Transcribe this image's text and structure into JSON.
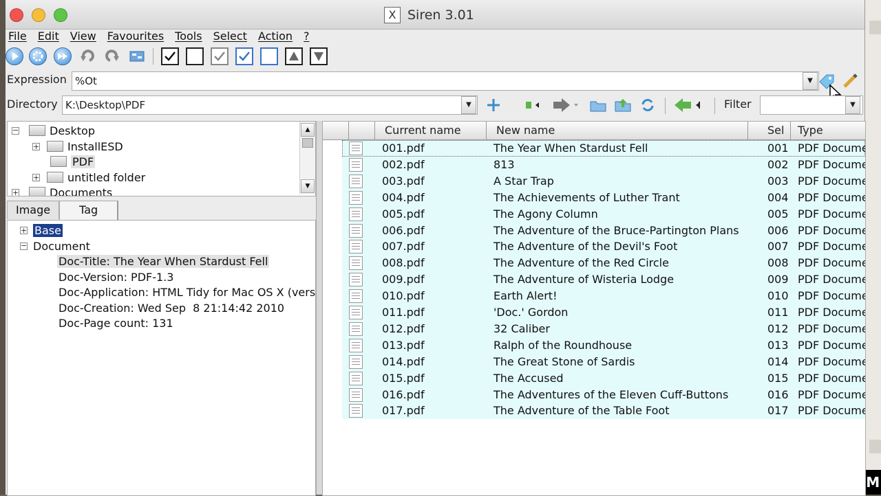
{
  "window": {
    "title": "Siren 3.01",
    "logo_glyph": "X"
  },
  "menu": [
    "File",
    "Edit",
    "View",
    "Favourites",
    "Tools",
    "Select",
    "Action",
    "?"
  ],
  "expression": {
    "label": "Expression",
    "value": "%Ot"
  },
  "directory": {
    "label": "Directory",
    "value": "K:\\Desktop\\PDF"
  },
  "filter": {
    "label": "Filter",
    "value": ""
  },
  "tree": {
    "items": [
      {
        "label": "Desktop",
        "expander": "−"
      },
      {
        "label": "InstallESD",
        "expander": "+"
      },
      {
        "label": "PDF",
        "expander": ""
      },
      {
        "label": "untitled folder",
        "expander": "+"
      },
      {
        "label": "Documents",
        "expander": "+"
      }
    ]
  },
  "tabs": [
    "Image",
    "Tag"
  ],
  "tag_tree": {
    "base": "Base",
    "document": "Document",
    "entries": [
      "Doc-Title: The Year When Stardust Fell",
      "Doc-Version: PDF-1.3",
      "Doc-Application: HTML Tidy for Mac OS X (vers",
      "Doc-Creation: Wed Sep  8 21:14:42 2010",
      "Doc-Page count: 131"
    ]
  },
  "list": {
    "columns": [
      "Current name",
      "New name",
      "Sel",
      "Type"
    ],
    "rows": [
      [
        "001.pdf",
        "The Year When Stardust Fell",
        "001",
        "PDF Docume"
      ],
      [
        "002.pdf",
        "813",
        "002",
        "PDF Docume"
      ],
      [
        "003.pdf",
        "A Star Trap",
        "003",
        "PDF Docume"
      ],
      [
        "004.pdf",
        "The Achievements of Luther Trant",
        "004",
        "PDF Docume"
      ],
      [
        "005.pdf",
        "The Agony Column",
        "005",
        "PDF Docume"
      ],
      [
        "006.pdf",
        "The Adventure of the Bruce-Partington Plans",
        "006",
        "PDF Docume"
      ],
      [
        "007.pdf",
        "The Adventure of the Devil's Foot",
        "007",
        "PDF Docume"
      ],
      [
        "008.pdf",
        "The Adventure of the Red Circle",
        "008",
        "PDF Docume"
      ],
      [
        "009.pdf",
        "The Adventure of Wisteria Lodge",
        "009",
        "PDF Docume"
      ],
      [
        "010.pdf",
        "Earth Alert!",
        "010",
        "PDF Docume"
      ],
      [
        "011.pdf",
        "'Doc.' Gordon",
        "011",
        "PDF Docume"
      ],
      [
        "012.pdf",
        "32 Caliber",
        "012",
        "PDF Docume"
      ],
      [
        "013.pdf",
        "Ralph of the Roundhouse",
        "013",
        "PDF Docume"
      ],
      [
        "014.pdf",
        "The Great Stone of Sardis",
        "014",
        "PDF Docume"
      ],
      [
        "015.pdf",
        "The Accused",
        "015",
        "PDF Docume"
      ],
      [
        "016.pdf",
        "The Adventures of the Eleven Cuff-Buttons",
        "016",
        "PDF Docume"
      ],
      [
        "017.pdf",
        "The Adventure of the Table Foot",
        "017",
        "PDF Docume"
      ]
    ]
  },
  "watermark": "FFM",
  "colors": {
    "row_bg": "#e4fbfb",
    "selection": "#1c3e8c"
  }
}
